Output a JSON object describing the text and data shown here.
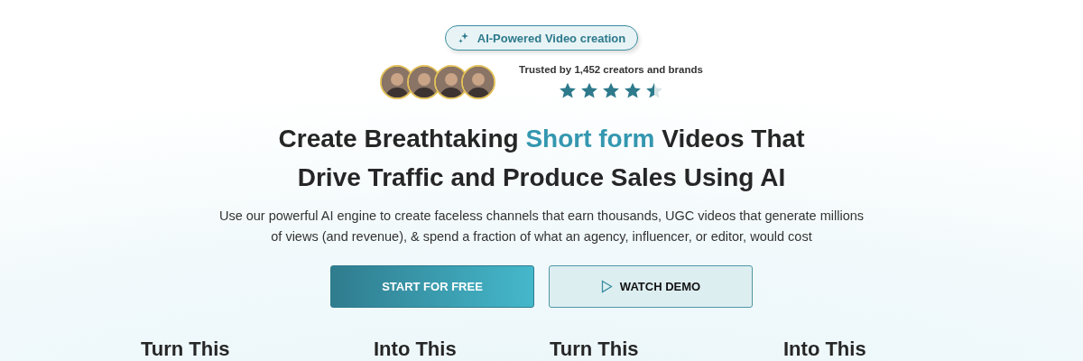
{
  "badge": {
    "label": "AI-Powered Video creation"
  },
  "trust": {
    "avatars": [
      {
        "kind": "picture"
      },
      {
        "kind": "picture"
      },
      {
        "kind": "picture"
      },
      {
        "kind": "picture"
      }
    ],
    "text": "Trusted by 1,452 creators and brands",
    "stars": 4.5
  },
  "headline": {
    "lines": [
      "Create Breathtaking **Short form** Videos That",
      "Drive Traffic and Produce Sales Using AI"
    ]
  },
  "subtitle": "Use our powerful AI engine to create faceless channels that earn thousands, UGC videos that generate millions of views (and revenue), & spend a fraction of what an agency, influencer, or editor, would cost",
  "buttons": [
    {
      "kind": "primary",
      "label": "START FOR FREE"
    },
    {
      "kind": "secondary",
      "label": "WATCH DEMO"
    }
  ],
  "columns": [
    "Turn This",
    "Into This",
    "Turn This",
    "Into This"
  ]
}
